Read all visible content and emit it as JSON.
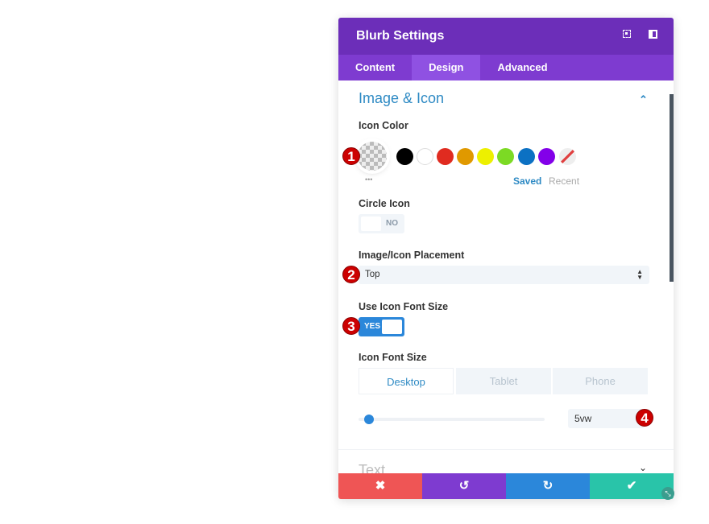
{
  "header": {
    "title": "Blurb Settings",
    "icons": [
      "fullscreen-icon",
      "sidebar-toggle-icon"
    ]
  },
  "tabs": [
    {
      "label": "Content"
    },
    {
      "label": "Design",
      "active": true
    },
    {
      "label": "Advanced"
    }
  ],
  "section": {
    "title": "Image & Icon",
    "collapsed_title": "Text"
  },
  "icon_color": {
    "label": "Icon Color",
    "swatches": [
      "#000000",
      "#ffffff",
      "#e02b20",
      "#e09900",
      "#edf000",
      "#7cda24",
      "#0c71c3",
      "#8300e9"
    ],
    "saved": "Saved",
    "recent": "Recent",
    "more": "•••"
  },
  "circle_icon": {
    "label": "Circle Icon",
    "value": "NO"
  },
  "placement": {
    "label": "Image/Icon Placement",
    "value": "Top"
  },
  "use_font_size": {
    "label": "Use Icon Font Size",
    "value": "YES"
  },
  "font_size": {
    "label": "Icon Font Size",
    "devices": [
      "Desktop",
      "Tablet",
      "Phone"
    ],
    "active_device": "Desktop",
    "value": "5vw"
  },
  "badges": [
    "1",
    "2",
    "3",
    "4"
  ],
  "colors": {
    "header": "#6c2eb9",
    "tabs": "#7e3bd0",
    "cancel": "#ef5555",
    "undo": "#7e3bd0",
    "redo": "#2b87da",
    "save": "#29c4a9"
  }
}
